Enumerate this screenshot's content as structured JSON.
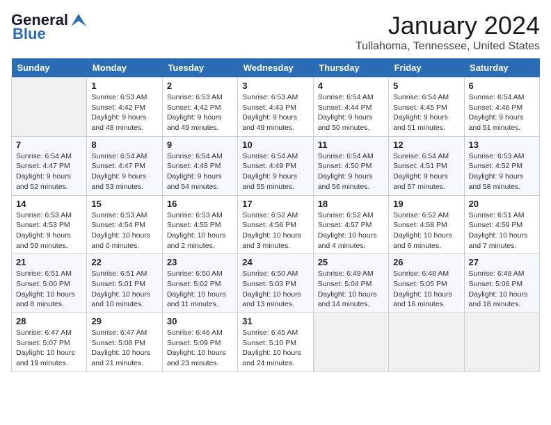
{
  "header": {
    "logo_line1": "General",
    "logo_line2": "Blue",
    "month_title": "January 2024",
    "location": "Tullahoma, Tennessee, United States"
  },
  "calendar": {
    "days_of_week": [
      "Sunday",
      "Monday",
      "Tuesday",
      "Wednesday",
      "Thursday",
      "Friday",
      "Saturday"
    ],
    "weeks": [
      [
        {
          "day": "",
          "info": ""
        },
        {
          "day": "1",
          "info": "Sunrise: 6:53 AM\nSunset: 4:42 PM\nDaylight: 9 hours\nand 48 minutes."
        },
        {
          "day": "2",
          "info": "Sunrise: 6:53 AM\nSunset: 4:42 PM\nDaylight: 9 hours\nand 49 minutes."
        },
        {
          "day": "3",
          "info": "Sunrise: 6:53 AM\nSunset: 4:43 PM\nDaylight: 9 hours\nand 49 minutes."
        },
        {
          "day": "4",
          "info": "Sunrise: 6:54 AM\nSunset: 4:44 PM\nDaylight: 9 hours\nand 50 minutes."
        },
        {
          "day": "5",
          "info": "Sunrise: 6:54 AM\nSunset: 4:45 PM\nDaylight: 9 hours\nand 51 minutes."
        },
        {
          "day": "6",
          "info": "Sunrise: 6:54 AM\nSunset: 4:46 PM\nDaylight: 9 hours\nand 51 minutes."
        }
      ],
      [
        {
          "day": "7",
          "info": "Sunrise: 6:54 AM\nSunset: 4:47 PM\nDaylight: 9 hours\nand 52 minutes."
        },
        {
          "day": "8",
          "info": "Sunrise: 6:54 AM\nSunset: 4:47 PM\nDaylight: 9 hours\nand 53 minutes."
        },
        {
          "day": "9",
          "info": "Sunrise: 6:54 AM\nSunset: 4:48 PM\nDaylight: 9 hours\nand 54 minutes."
        },
        {
          "day": "10",
          "info": "Sunrise: 6:54 AM\nSunset: 4:49 PM\nDaylight: 9 hours\nand 55 minutes."
        },
        {
          "day": "11",
          "info": "Sunrise: 6:54 AM\nSunset: 4:50 PM\nDaylight: 9 hours\nand 56 minutes."
        },
        {
          "day": "12",
          "info": "Sunrise: 6:54 AM\nSunset: 4:51 PM\nDaylight: 9 hours\nand 57 minutes."
        },
        {
          "day": "13",
          "info": "Sunrise: 6:53 AM\nSunset: 4:52 PM\nDaylight: 9 hours\nand 58 minutes."
        }
      ],
      [
        {
          "day": "14",
          "info": "Sunrise: 6:53 AM\nSunset: 4:53 PM\nDaylight: 9 hours\nand 59 minutes."
        },
        {
          "day": "15",
          "info": "Sunrise: 6:53 AM\nSunset: 4:54 PM\nDaylight: 10 hours\nand 0 minutes."
        },
        {
          "day": "16",
          "info": "Sunrise: 6:53 AM\nSunset: 4:55 PM\nDaylight: 10 hours\nand 2 minutes."
        },
        {
          "day": "17",
          "info": "Sunrise: 6:52 AM\nSunset: 4:56 PM\nDaylight: 10 hours\nand 3 minutes."
        },
        {
          "day": "18",
          "info": "Sunrise: 6:52 AM\nSunset: 4:57 PM\nDaylight: 10 hours\nand 4 minutes."
        },
        {
          "day": "19",
          "info": "Sunrise: 6:52 AM\nSunset: 4:58 PM\nDaylight: 10 hours\nand 6 minutes."
        },
        {
          "day": "20",
          "info": "Sunrise: 6:51 AM\nSunset: 4:59 PM\nDaylight: 10 hours\nand 7 minutes."
        }
      ],
      [
        {
          "day": "21",
          "info": "Sunrise: 6:51 AM\nSunset: 5:00 PM\nDaylight: 10 hours\nand 8 minutes."
        },
        {
          "day": "22",
          "info": "Sunrise: 6:51 AM\nSunset: 5:01 PM\nDaylight: 10 hours\nand 10 minutes."
        },
        {
          "day": "23",
          "info": "Sunrise: 6:50 AM\nSunset: 5:02 PM\nDaylight: 10 hours\nand 11 minutes."
        },
        {
          "day": "24",
          "info": "Sunrise: 6:50 AM\nSunset: 5:03 PM\nDaylight: 10 hours\nand 13 minutes."
        },
        {
          "day": "25",
          "info": "Sunrise: 6:49 AM\nSunset: 5:04 PM\nDaylight: 10 hours\nand 14 minutes."
        },
        {
          "day": "26",
          "info": "Sunrise: 6:48 AM\nSunset: 5:05 PM\nDaylight: 10 hours\nand 16 minutes."
        },
        {
          "day": "27",
          "info": "Sunrise: 6:48 AM\nSunset: 5:06 PM\nDaylight: 10 hours\nand 18 minutes."
        }
      ],
      [
        {
          "day": "28",
          "info": "Sunrise: 6:47 AM\nSunset: 5:07 PM\nDaylight: 10 hours\nand 19 minutes."
        },
        {
          "day": "29",
          "info": "Sunrise: 6:47 AM\nSunset: 5:08 PM\nDaylight: 10 hours\nand 21 minutes."
        },
        {
          "day": "30",
          "info": "Sunrise: 6:46 AM\nSunset: 5:09 PM\nDaylight: 10 hours\nand 23 minutes."
        },
        {
          "day": "31",
          "info": "Sunrise: 6:45 AM\nSunset: 5:10 PM\nDaylight: 10 hours\nand 24 minutes."
        },
        {
          "day": "",
          "info": ""
        },
        {
          "day": "",
          "info": ""
        },
        {
          "day": "",
          "info": ""
        }
      ]
    ]
  }
}
